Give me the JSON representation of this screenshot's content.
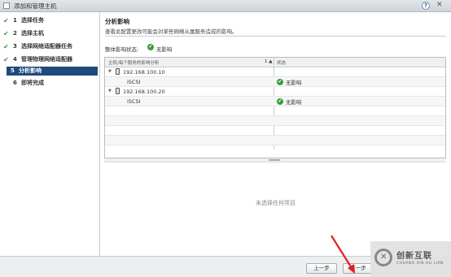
{
  "window": {
    "title": "添加和管理主机",
    "help_glyph": "?",
    "close_glyph": "✕"
  },
  "steps": [
    {
      "num": "1",
      "label": "选择任务",
      "done": true
    },
    {
      "num": "2",
      "label": "选择主机",
      "done": true
    },
    {
      "num": "3",
      "label": "选择网络适配器任务",
      "done": true
    },
    {
      "num": "4",
      "label": "管理物理网络适配器",
      "done": true
    },
    {
      "num": "5",
      "label": "分析影响",
      "current": true
    },
    {
      "num": "6",
      "label": "即将完成"
    }
  ],
  "main": {
    "heading": "分析影响",
    "description": "查看此配置更改可能会对某些网络从属服务造成的影响。",
    "overall_label": "整体影响状态:",
    "overall_value": "无影响",
    "table": {
      "col1": "主机/每个服务的影响分析",
      "sort_indicator": "1 ▲",
      "col2": "状态",
      "rows": [
        {
          "host": "192.168.100.10",
          "adapter": "iSCSI",
          "status": "无影响"
        },
        {
          "host": "192.168.100.20",
          "adapter": "iSCSI",
          "status": "无影响"
        }
      ]
    },
    "empty_text": "未选择任何项目"
  },
  "footer": {
    "back_label": "上一步",
    "next_label": "下一步"
  },
  "watermark": {
    "cn": "创新互联",
    "en": "CHUANG XIN HU LIAN"
  },
  "colors": {
    "selected_step_bg": "#1f4a7d",
    "ok_green": "#3a9d3a",
    "annotation_arrow": "#e02020"
  }
}
